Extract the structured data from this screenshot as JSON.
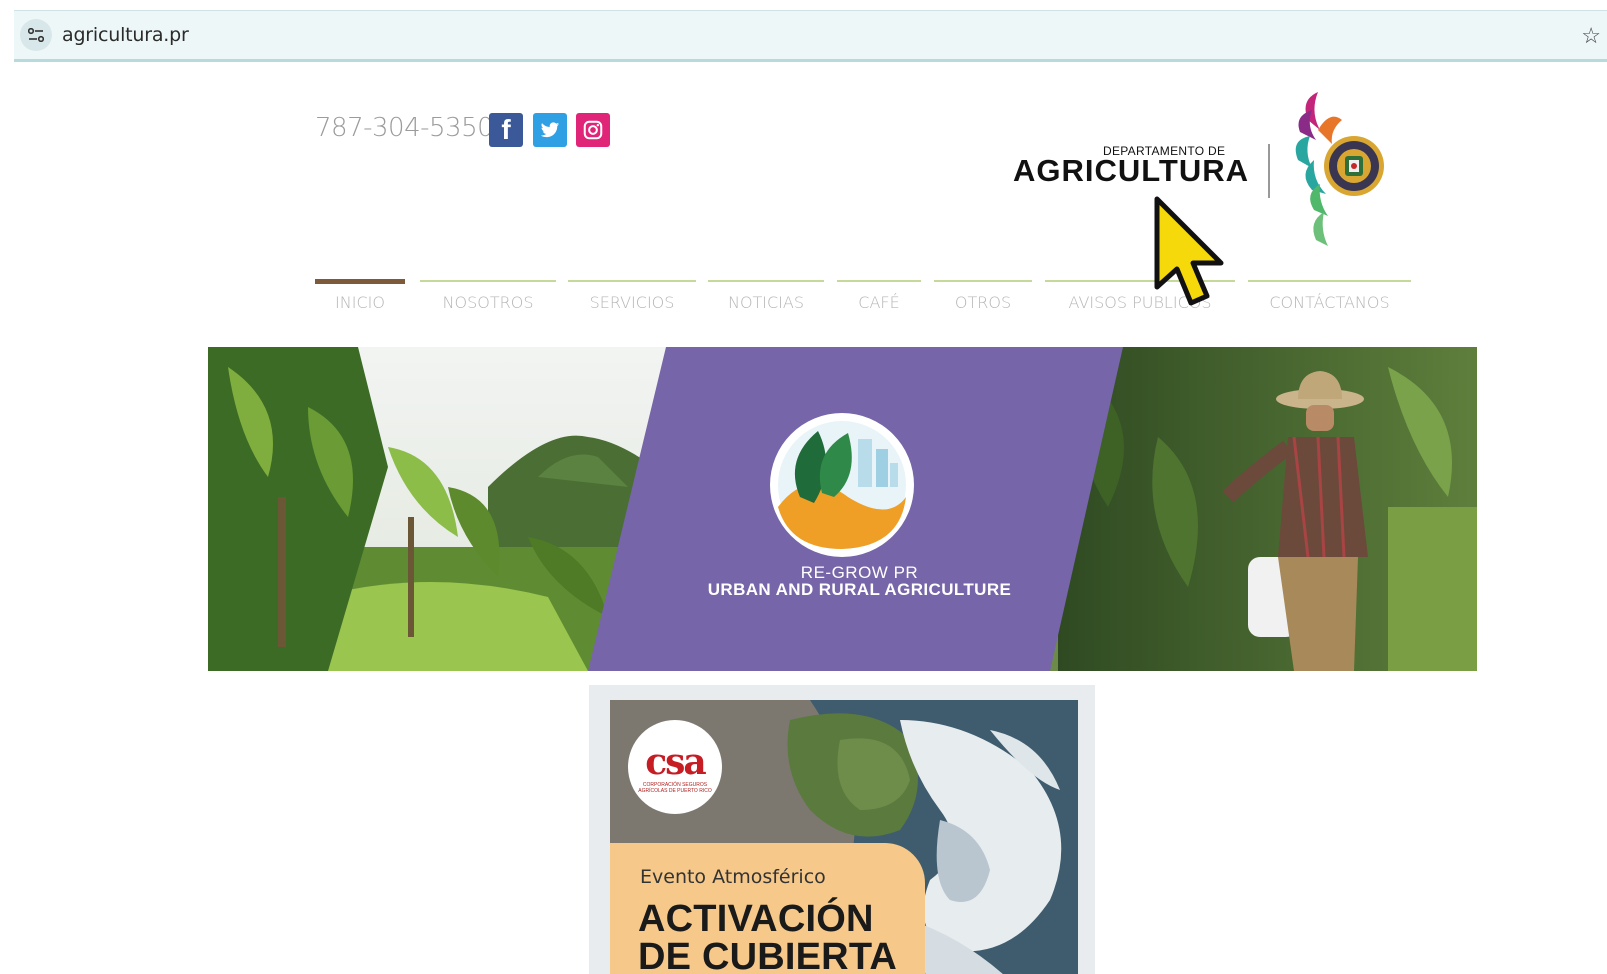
{
  "browser": {
    "url": "agricultura.pr",
    "site_settings_icon": "tune-icon",
    "bookmark_icon": "star-outline-icon"
  },
  "header": {
    "phone": "787-304-5350",
    "social": [
      {
        "name": "facebook-icon",
        "glyph": "f",
        "color": "#3b5998"
      },
      {
        "name": "twitter-icon",
        "color": "#2ea0e3"
      },
      {
        "name": "instagram-icon",
        "color": "#e02478"
      }
    ],
    "dept_small": "DEPARTAMENTO DE",
    "dept_big": "AGRICULTURA"
  },
  "nav": {
    "items": [
      {
        "label": "INICIO",
        "active": true
      },
      {
        "label": "NOSOTROS",
        "active": false
      },
      {
        "label": "SERVICIOS",
        "active": false
      },
      {
        "label": "NOTICIAS",
        "active": false
      },
      {
        "label": "CAFÉ",
        "active": false
      },
      {
        "label": "OTROS",
        "active": false
      },
      {
        "label": "AVISOS PUBLICOS",
        "active": false
      },
      {
        "label": "CONTÁCTANOS",
        "active": false
      }
    ]
  },
  "hero": {
    "subtitle": "RE-GROW PR",
    "title": "URBAN AND RURAL AGRICULTURE",
    "panel_color": "#7665a8"
  },
  "promo": {
    "logo_text": "csa",
    "logo_small": "CORPORACIÓN SEGUROS AGRÍCOLAS DE PUERTO RICO",
    "event_label": "Evento Atmosférico",
    "headline_line1": "ACTIVACIÓN",
    "headline_line2": "DE CUBIERTA"
  },
  "colors": {
    "nav_active": "#7d5a3a",
    "nav_line": "#c4d99a",
    "cursor": "#f5d90a"
  }
}
